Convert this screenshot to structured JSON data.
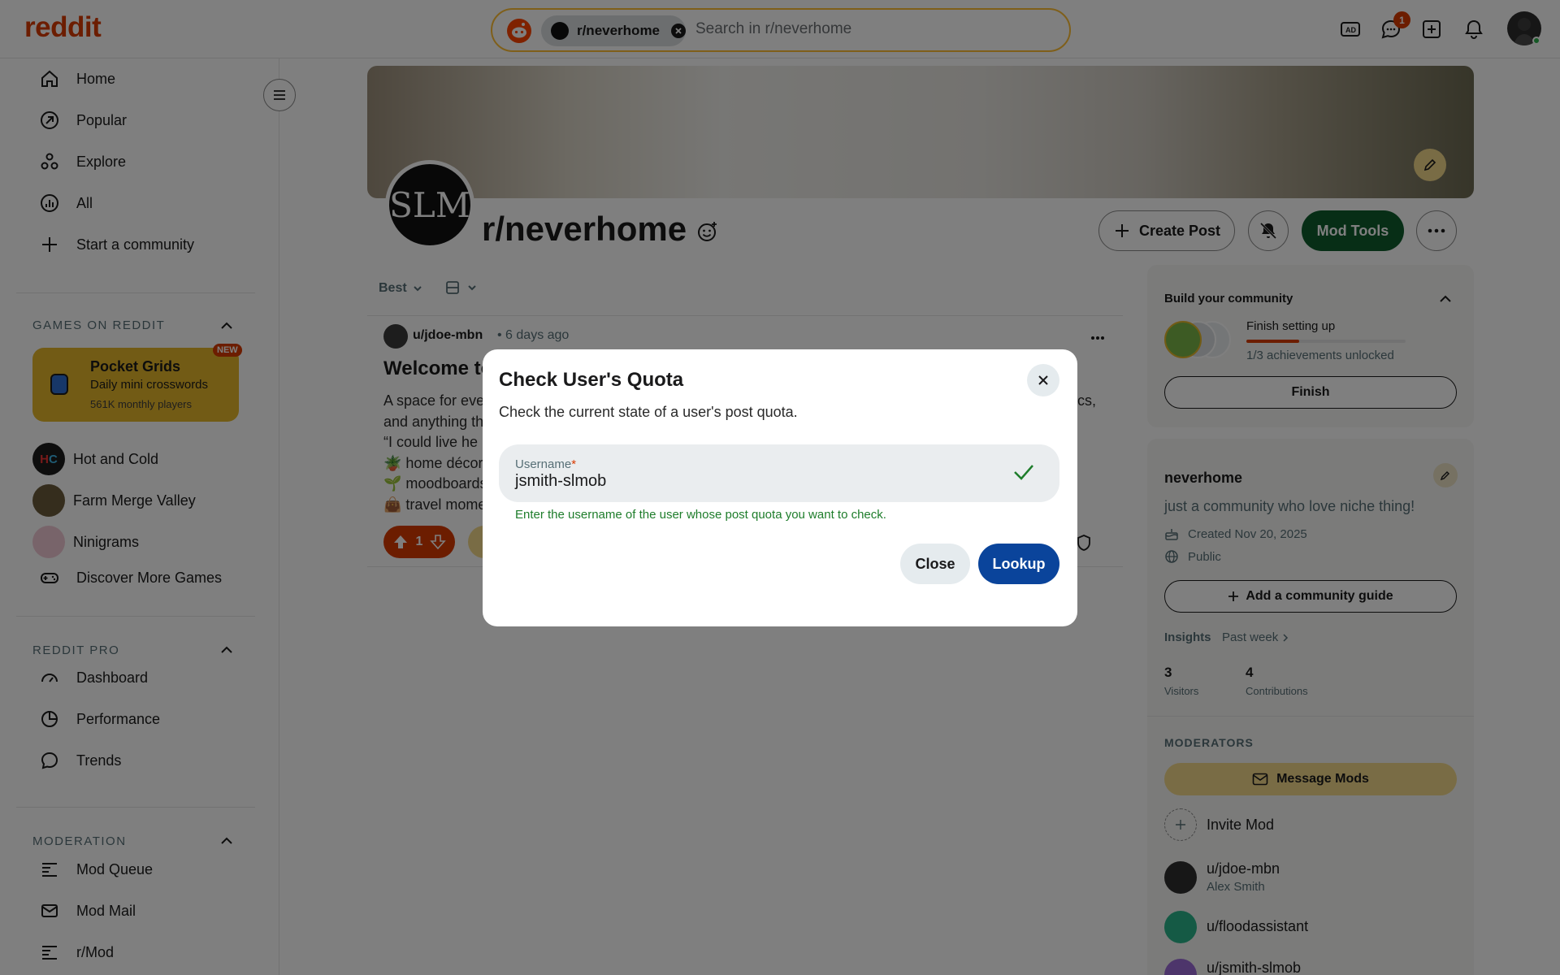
{
  "header": {
    "logo": "reddit",
    "search_chip": "r/neverhome",
    "search_placeholder": "Search in r/neverhome",
    "messages_badge": "1"
  },
  "sidebar": {
    "nav": [
      {
        "label": "Home",
        "icon": "home-icon"
      },
      {
        "label": "Popular",
        "icon": "popular-icon"
      },
      {
        "label": "Explore",
        "icon": "explore-icon"
      },
      {
        "label": "All",
        "icon": "all-icon"
      },
      {
        "label": "Start a community",
        "icon": "plus-icon"
      }
    ],
    "games_header": "GAMES ON REDDIT",
    "featured_game": {
      "title": "Pocket Grids",
      "subtitle": "Daily mini crosswords",
      "players": "561K monthly players",
      "badge": "NEW"
    },
    "games": [
      "Hot and Cold",
      "Farm Merge Valley",
      "Ninigrams",
      "Discover More Games"
    ],
    "pro_header": "REDDIT PRO",
    "pro_items": [
      "Dashboard",
      "Performance",
      "Trends"
    ],
    "mod_header": "MODERATION",
    "mod_items": [
      "Mod Queue",
      "Mod Mail",
      "r/Mod"
    ]
  },
  "community": {
    "name": "r/neverhome",
    "avatar_text": "SLM",
    "create_post": "Create Post",
    "mod_tools": "Mod Tools"
  },
  "feed": {
    "sort": "Best"
  },
  "post": {
    "author": "u/jdoe-mbn",
    "time": "• 6 days ago",
    "title": "Welcome to",
    "lines": [
      "A space for eve",
      "and anything th",
      "“I could live he",
      "🪴 home décor",
      "🌱 moodboards",
      "👜 travel mome"
    ],
    "line_tail": "cs,",
    "votes": "1"
  },
  "right_panel": {
    "build_title": "Build your community",
    "finish_setting": "Finish setting up",
    "achievements": "1/3 achievements unlocked",
    "progress": 0.33,
    "finish_button": "Finish",
    "name": "neverhome",
    "description": "just a community who love niche thing!",
    "created": "Created Nov 20, 2025",
    "visibility": "Public",
    "add_guide": "Add a community guide",
    "insights": "Insights",
    "insights_period": "Past week",
    "visitors_value": "3",
    "visitors_label": "Visitors",
    "contrib_value": "4",
    "contrib_label": "Contributions",
    "moderators_header": "MODERATORS",
    "message_mods": "Message Mods",
    "invite_mod": "Invite Mod",
    "mods": [
      {
        "name": "u/jdoe-mbn",
        "sub": "Alex Smith"
      },
      {
        "name": "u/floodassistant",
        "sub": ""
      },
      {
        "name": "u/jsmith-slmob",
        "sub": ""
      }
    ]
  },
  "modal": {
    "title": "Check User's Quota",
    "description": "Check the current state of a user's post quota.",
    "field_label": "Username",
    "required_mark": "*",
    "field_value": "jsmith-slmob",
    "helper": "Enter the username of the user whose post quota you want to check.",
    "close_label": "Close",
    "lookup_label": "Lookup"
  },
  "colors": {
    "brand": "#d93a00",
    "mod_tools": "#0e5c2c",
    "lookup": "#0a449b",
    "helper_green": "#1e7d2b"
  }
}
